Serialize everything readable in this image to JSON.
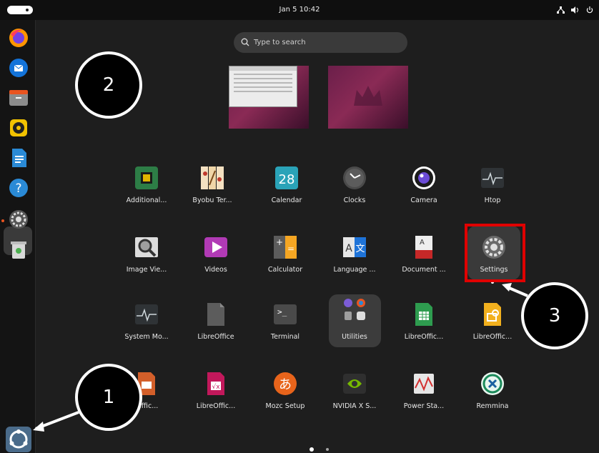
{
  "topbar": {
    "clock": "Jan 5  10:42"
  },
  "search": {
    "placeholder": "Type to search"
  },
  "dock": {
    "items": [
      "firefox",
      "thunderbird",
      "files",
      "rhythmbox",
      "libreoffice-writer",
      "help",
      "settings",
      "trash"
    ]
  },
  "apps": [
    {
      "label": "Additional...",
      "icon": "chip-icon"
    },
    {
      "label": "Byobu Ter...",
      "icon": "byobu-icon"
    },
    {
      "label": "Calendar",
      "icon": "calendar-icon",
      "badge": "28"
    },
    {
      "label": "Clocks",
      "icon": "clock-icon"
    },
    {
      "label": "Camera",
      "icon": "camera-icon"
    },
    {
      "label": "Htop",
      "icon": "htop-icon"
    },
    {
      "label": "Image Vie...",
      "icon": "image-viewer-icon"
    },
    {
      "label": "Videos",
      "icon": "videos-icon"
    },
    {
      "label": "Calculator",
      "icon": "calculator-icon"
    },
    {
      "label": "Language ...",
      "icon": "language-icon"
    },
    {
      "label": "Document ...",
      "icon": "document-icon"
    },
    {
      "label": "Settings",
      "icon": "settings-icon"
    },
    {
      "label": "System Mo...",
      "icon": "system-monitor-icon"
    },
    {
      "label": "LibreOffice",
      "icon": "libreoffice-icon"
    },
    {
      "label": "Terminal",
      "icon": "terminal-icon"
    },
    {
      "label": "Utilities",
      "icon": "folder-icon"
    },
    {
      "label": "LibreOffic...",
      "icon": "libreoffice-calc-icon"
    },
    {
      "label": "LibreOffic...",
      "icon": "libreoffice-draw-icon"
    },
    {
      "label": "...ffic...",
      "icon": "libreoffice-impress-icon"
    },
    {
      "label": "LibreOffic...",
      "icon": "libreoffice-math-icon"
    },
    {
      "label": "Mozc Setup",
      "icon": "mozc-icon"
    },
    {
      "label": "NVIDIA X S...",
      "icon": "nvidia-icon"
    },
    {
      "label": "Power Sta...",
      "icon": "power-stats-icon"
    },
    {
      "label": "Remmina",
      "icon": "remmina-icon"
    }
  ],
  "callouts": [
    "1",
    "2",
    "3"
  ],
  "pager": {
    "current": 1,
    "total": 2
  },
  "colors": {
    "accent": "#e95420",
    "highlight": "#e00000"
  }
}
